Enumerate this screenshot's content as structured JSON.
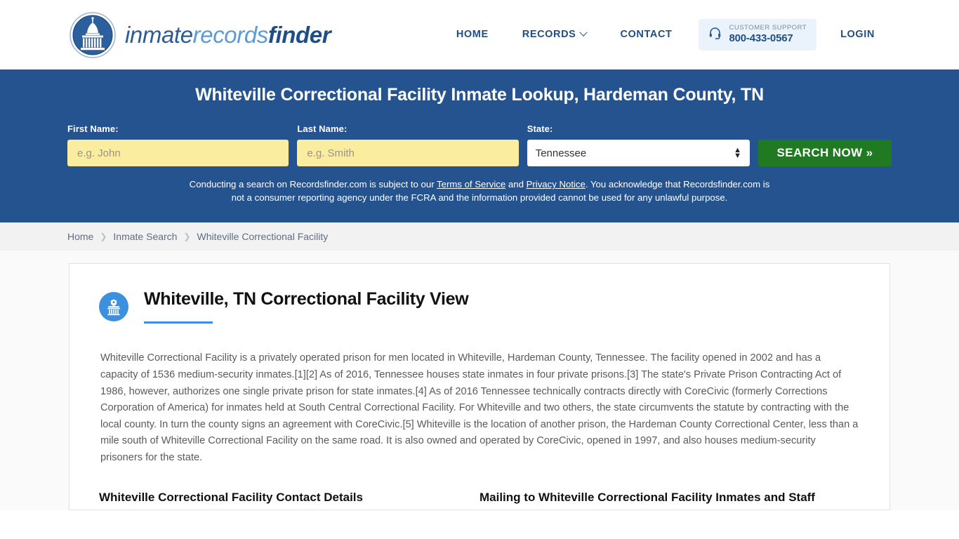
{
  "header": {
    "brand": {
      "part1": "inmate",
      "part2": "records",
      "part3": "finder"
    },
    "nav": [
      {
        "label": "HOME",
        "caret": false
      },
      {
        "label": "RECORDS",
        "caret": true
      },
      {
        "label": "CONTACT",
        "caret": false
      }
    ],
    "support": {
      "label": "CUSTOMER SUPPORT",
      "phone": "800-433-0567"
    },
    "login": "LOGIN"
  },
  "banner": {
    "title": "Whiteville Correctional Facility Inmate Lookup, Hardeman County, TN",
    "first_name": {
      "label": "First Name:",
      "placeholder": "e.g. John",
      "value": ""
    },
    "last_name": {
      "label": "Last Name:",
      "placeholder": "e.g. Smith",
      "value": ""
    },
    "state": {
      "label": "State:",
      "selected": "Tennessee"
    },
    "search_button": "SEARCH NOW »",
    "disclaimer": {
      "part1": "Conducting a search on Recordsfinder.com is subject to our ",
      "link1": "Terms of Service",
      "part2": " and ",
      "link2": "Privacy Notice",
      "part3": ". You acknowledge that Recordsfinder.com is not a consumer reporting agency under the FCRA and the information provided cannot be used for any unlawful purpose."
    }
  },
  "breadcrumb": [
    {
      "label": "Home"
    },
    {
      "label": "Inmate Search"
    },
    {
      "label": "Whiteville Correctional Facility"
    }
  ],
  "main": {
    "title": "Whiteville, TN Correctional Facility View",
    "body": "Whiteville Correctional Facility is a privately operated prison for men located in Whiteville, Hardeman County, Tennessee. The facility opened in 2002 and has a capacity of 1536 medium-security inmates.[1][2] As of 2016, Tennessee houses state inmates in four private prisons.[3] The state's Private Prison Contracting Act of 1986, however, authorizes one single private prison for state inmates.[4] As of 2016 Tennessee technically contracts directly with CoreCivic (formerly Corrections Corporation of America) for inmates held at South Central Correctional Facility. For Whiteville and two others, the state circumvents the statute by contracting with the local county. In turn the county signs an agreement with CoreCivic.[5] Whiteville is the location of another prison, the Hardeman County Correctional Center, less than a mile south of Whiteville Correctional Facility on the same road. It is also owned and operated by CoreCivic, opened in 1997, and also houses medium-security prisoners for the state.",
    "section_left": "Whiteville Correctional Facility Contact Details",
    "section_right": "Mailing to Whiteville Correctional Facility Inmates and Staff"
  },
  "colors": {
    "banner_blue": "#25538f",
    "brand_dark": "#1f4e85",
    "brand_light": "#5b9bd5",
    "input_yellow": "#fbeda0",
    "search_green": "#1f7a21",
    "accent_blue": "#3d8fe0"
  }
}
